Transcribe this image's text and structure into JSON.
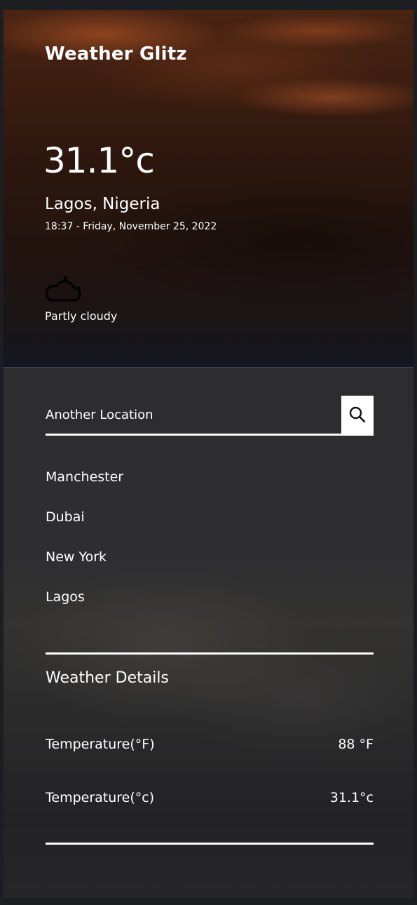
{
  "app": {
    "brand": "Weather Glitz"
  },
  "current": {
    "temperature": "31.1°c",
    "location": "Lagos, Nigeria",
    "datetime": "18:37 - Friday, November 25, 2022",
    "condition": "Partly cloudy",
    "condition_icon": "partly-cloudy-night-icon"
  },
  "search": {
    "placeholder": "Another Location",
    "button_icon": "search-icon"
  },
  "cities": [
    {
      "label": "Manchester"
    },
    {
      "label": "Dubai"
    },
    {
      "label": "New York"
    },
    {
      "label": "Lagos"
    }
  ],
  "details": {
    "title": "Weather Details",
    "rows": [
      {
        "label": "Temperature(°F)",
        "value": "88 °F"
      },
      {
        "label": "Temperature(°c)",
        "value": "31.1°c"
      }
    ]
  },
  "colors": {
    "panel_background": "#2d2d30",
    "hero_background": "#2b160d",
    "text": "#ffffff",
    "search_button": "#ffffff"
  }
}
